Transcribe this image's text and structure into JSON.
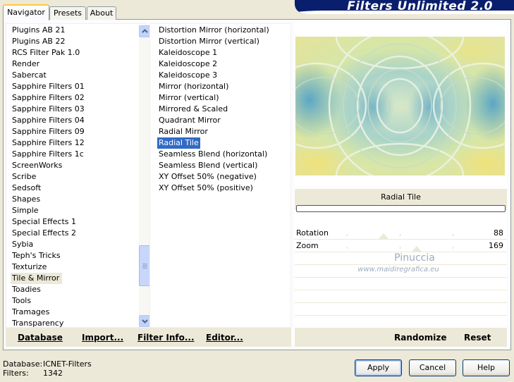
{
  "banner": {
    "title": "Filters Unlimited 2.0"
  },
  "tabs": [
    {
      "label": "Navigator"
    },
    {
      "label": "Presets"
    },
    {
      "label": "About"
    }
  ],
  "categories": {
    "items": [
      "Plugins AB 21",
      "Plugins AB 22",
      "RCS Filter Pak 1.0",
      "Render",
      "Sabercat",
      "Sapphire Filters 01",
      "Sapphire Filters 02",
      "Sapphire Filters 03",
      "Sapphire Filters 04",
      "Sapphire Filters 09",
      "Sapphire Filters 12",
      "Sapphire Filters 1c",
      "ScreenWorks",
      "Scribe",
      "Sedsoft",
      "Shapes",
      "Simple",
      "Special Effects 1",
      "Special Effects 2",
      "Sybia",
      "Teph's Tricks",
      "Texturize",
      "Tile & Mirror",
      "Toadies",
      "Tools",
      "Tramages",
      "Transparency"
    ],
    "selected": "Tile & Mirror"
  },
  "filters": {
    "items": [
      "Distortion Mirror (horizontal)",
      "Distortion Mirror (vertical)",
      "Kaleidoscope 1",
      "Kaleidoscope 2",
      "Kaleidoscope 3",
      "Mirror (horizontal)",
      "Mirror (vertical)",
      "Mirrored & Scaled",
      "Quadrant Mirror",
      "Radial Mirror",
      "Radial Tile",
      "Seamless Blend (horizontal)",
      "Seamless Blend (vertical)",
      "XY Offset 50% (negative)",
      "XY Offset 50% (positive)"
    ],
    "selected": "Radial Tile"
  },
  "toolbar": {
    "database": "Database",
    "import": "Import...",
    "filter_info": "Filter Info...",
    "editor": "Editor..."
  },
  "preview": {
    "filter_title": "Radial Tile",
    "params": [
      {
        "label": "Rotation",
        "value": "88",
        "fraction": 0.345
      },
      {
        "label": "Zoom",
        "value": "169",
        "fraction": 0.663
      }
    ],
    "watermark": "Pinuccia",
    "watermark_sub": "www.maidiregrafica.eu",
    "randomize": "Randomize",
    "reset": "Reset"
  },
  "footer": {
    "database_label": "Database:",
    "database_value": "ICNET-Filters",
    "filters_label": "Filters:",
    "filters_value": "1342"
  },
  "buttons": {
    "apply": "Apply",
    "cancel": "Cancel",
    "help": "Help"
  },
  "colors": {
    "banner": "#0A1E6E",
    "selection": "#316AC5",
    "dialog_bg": "#ECE9D8"
  }
}
